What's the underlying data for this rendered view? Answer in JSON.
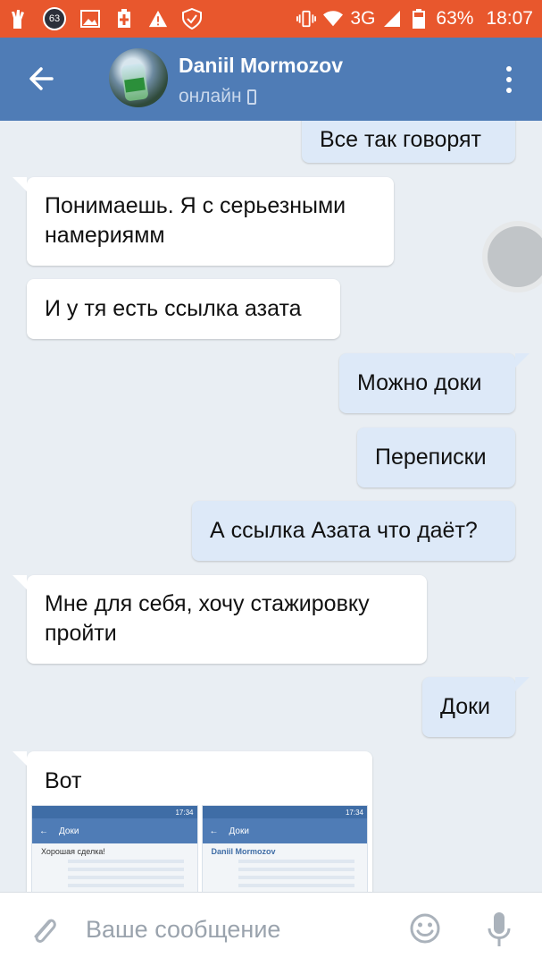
{
  "status_bar": {
    "notification_count": "63",
    "network": "3G",
    "battery": "63%",
    "time": "18:07"
  },
  "header": {
    "contact_name": "Daniil Mormozov",
    "status": "онлайн"
  },
  "messages": [
    {
      "direction": "out",
      "text": "Все так говорят"
    },
    {
      "direction": "in",
      "text": "Понимаешь. Я с серьезными намериямм"
    },
    {
      "direction": "in",
      "text": "И у тя есть ссылка азата"
    },
    {
      "direction": "out",
      "text": "Можно доки"
    },
    {
      "direction": "out",
      "text": "Переписки"
    },
    {
      "direction": "out",
      "text": "А ссылка Азата что даёт?"
    },
    {
      "direction": "in",
      "text": "Мне для себя,  хочу стажировку пройти"
    },
    {
      "direction": "out",
      "text": "Доки"
    },
    {
      "direction": "in",
      "text": "Вот"
    }
  ],
  "attachments": [
    {
      "time": "17:34",
      "title": "Доки",
      "preview_text": "Хорошая сделка!"
    },
    {
      "time": "17:34",
      "title": "Доки",
      "preview_text": "Daniil Mormozov"
    }
  ],
  "input": {
    "placeholder": "Ваше сообщение"
  }
}
